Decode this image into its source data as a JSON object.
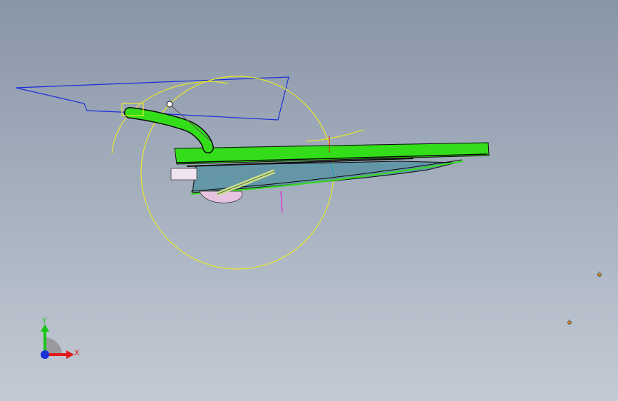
{
  "viewport": {
    "background_top": "#8996a8",
    "background_bottom": "#c3cad4"
  },
  "model": {
    "part_color": "#33dd1a",
    "sketch_blue": "#1a2fd6",
    "construction_yellow": "#e8e82a",
    "glass_tint": "#4f8fa0",
    "edge_color": "#0a0a0a",
    "reference_magenta": "#e020e0"
  },
  "triad": {
    "y_label": "Y",
    "x_label": "X",
    "y_color": "#17c617",
    "x_color": "#e01919",
    "z_color": "#1a2fd6"
  },
  "markers": [
    {
      "name": "reference-point-upper",
      "icon": "reference-point-icon"
    },
    {
      "name": "reference-point-lower",
      "icon": "reference-point-icon"
    }
  ]
}
